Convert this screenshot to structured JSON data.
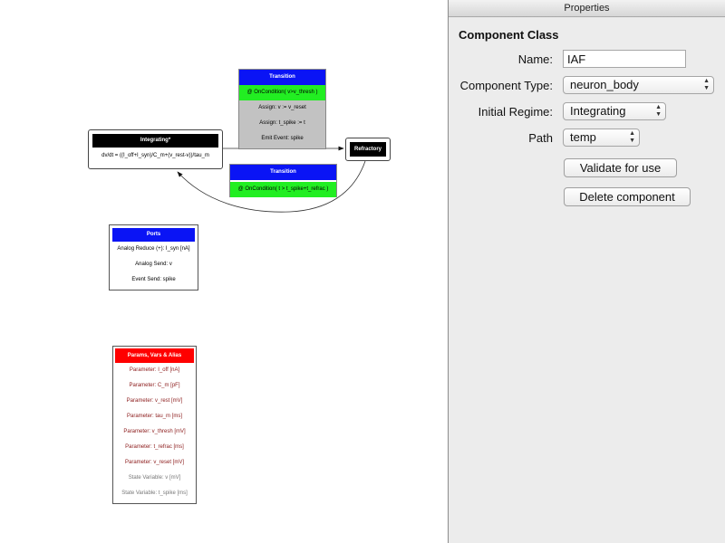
{
  "panel": {
    "title": "Properties",
    "section_title": "Component Class",
    "name_label": "Name:",
    "name_value": "IAF",
    "type_label": "Component Type:",
    "type_value": "neuron_body",
    "regime_label": "Initial Regime:",
    "regime_value": "Integrating",
    "path_label": "Path",
    "path_value": "temp",
    "validate_label": "Validate for use",
    "delete_label": "Delete component"
  },
  "diagram": {
    "regime_integrating": {
      "title": "Integrating*",
      "equation": "dv/dt = ((I_off+I_syn)/C_m+(v_rest-v))/tau_m"
    },
    "regime_refractory": {
      "title": "Refractory"
    },
    "transition_1": {
      "title": "Transition",
      "condition": "@ OnCondition( v>v_thresh )",
      "actions": [
        "Assign: v := v_reset",
        "Assign: t_spike := t",
        "Emit Event: spike"
      ]
    },
    "transition_2": {
      "title": "Transition",
      "condition": "@ OnCondition( t > t_spike+t_refrac )"
    },
    "ports": {
      "title": "Ports",
      "items": [
        "Analog Reduce (+): I_syn [nA]",
        "Analog Send: v",
        "Event Send: spike"
      ]
    },
    "params": {
      "title": "Params, Vars & Alias",
      "parameters": [
        "Parameter: I_off [nA]",
        "Parameter: C_m [pF]",
        "Parameter: v_rest [mV]",
        "Parameter: tau_m [ms]",
        "Parameter: v_thresh [mV]",
        "Parameter: t_refrac [ms]",
        "Parameter: v_reset [mV]"
      ],
      "state_variables": [
        "State Variable: v [mV]",
        "State Variable: t_spike [ms]"
      ]
    }
  },
  "colors": {
    "transition_header": "#0a14f5",
    "condition": "#22ee22",
    "params_header": "#ff0000",
    "regime_header": "#000000"
  }
}
